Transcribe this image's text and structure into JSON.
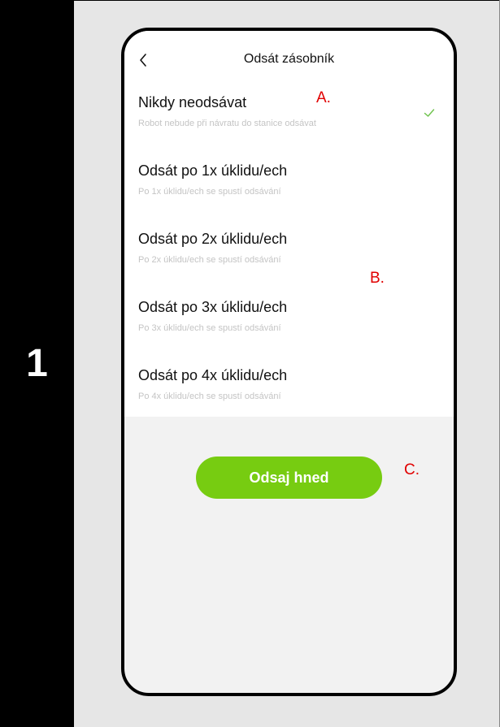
{
  "step": {
    "number": "1"
  },
  "screen": {
    "title": "Odsát zásobník",
    "back_icon": "chevron-left-icon"
  },
  "options": [
    {
      "label": "Nikdy neodsávat",
      "description": "Robot nebude při návratu do stanice odsávat",
      "selected": true
    },
    {
      "label": "Odsát po 1x úklidu/ech",
      "description": "Po 1x úklidu/ech se spustí odsávání",
      "selected": false
    },
    {
      "label": "Odsát po 2x úklidu/ech",
      "description": "Po 2x úklidu/ech se spustí odsávání",
      "selected": false
    },
    {
      "label": "Odsát po 3x úklidu/ech",
      "description": "Po 3x úklidu/ech se spustí odsávání",
      "selected": false
    },
    {
      "label": "Odsát po 4x úklidu/ech",
      "description": "Po 4x úklidu/ech se spustí odsávání",
      "selected": false
    }
  ],
  "action": {
    "label": "Odsaj hned"
  },
  "annotations": {
    "a": "A.",
    "b": "B.",
    "c": "C."
  },
  "colors": {
    "accent": "#77cc11",
    "check": "#6cc24a",
    "annotation": "#e10000",
    "description": "#c4c4c4"
  }
}
